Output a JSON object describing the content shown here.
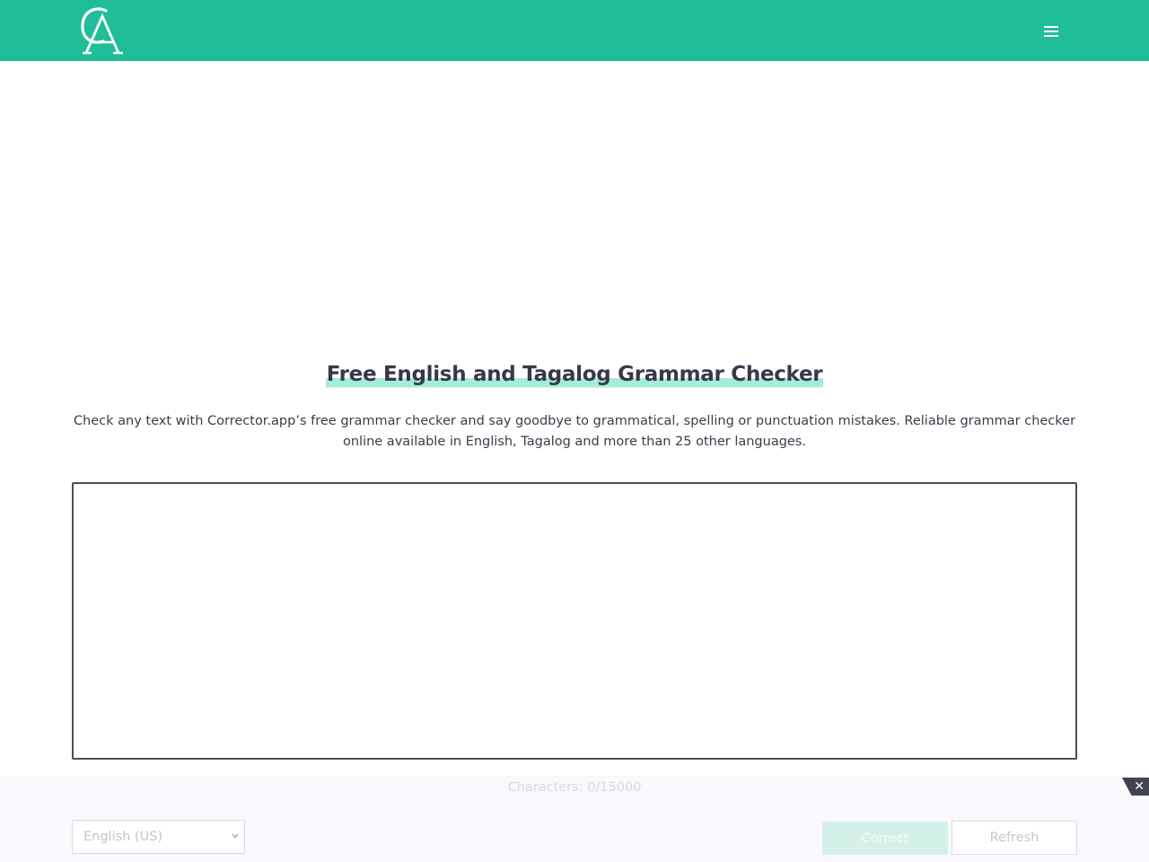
{
  "header": {
    "logo_alt": "Corrector.app",
    "logo_icon": "ca-monogram-logo",
    "menu_icon": "hamburger-menu-icon",
    "background_color": "#1fbd98"
  },
  "main": {
    "title": "Free English and Tagalog Grammar Checker",
    "description": "Check any text with Corrector.app’s free grammar checker and say goodbye to grammatical, spelling or punctuation mistakes. Reliable grammar checker online available in English, Tagalog and more than 25 other languages.",
    "editor": {
      "value": "",
      "placeholder": ""
    }
  },
  "toolbar": {
    "characters_label": "Characters: 0/15000",
    "language": {
      "selected": "English (US)",
      "options": [
        "English (US)"
      ]
    },
    "correct_label": "Correct",
    "refresh_label": "Refresh",
    "close_icon": "close-icon"
  },
  "colors": {
    "accent": "#1fbd98",
    "title_highlight": "#a6ecd9",
    "text": "#3c3c4a"
  }
}
